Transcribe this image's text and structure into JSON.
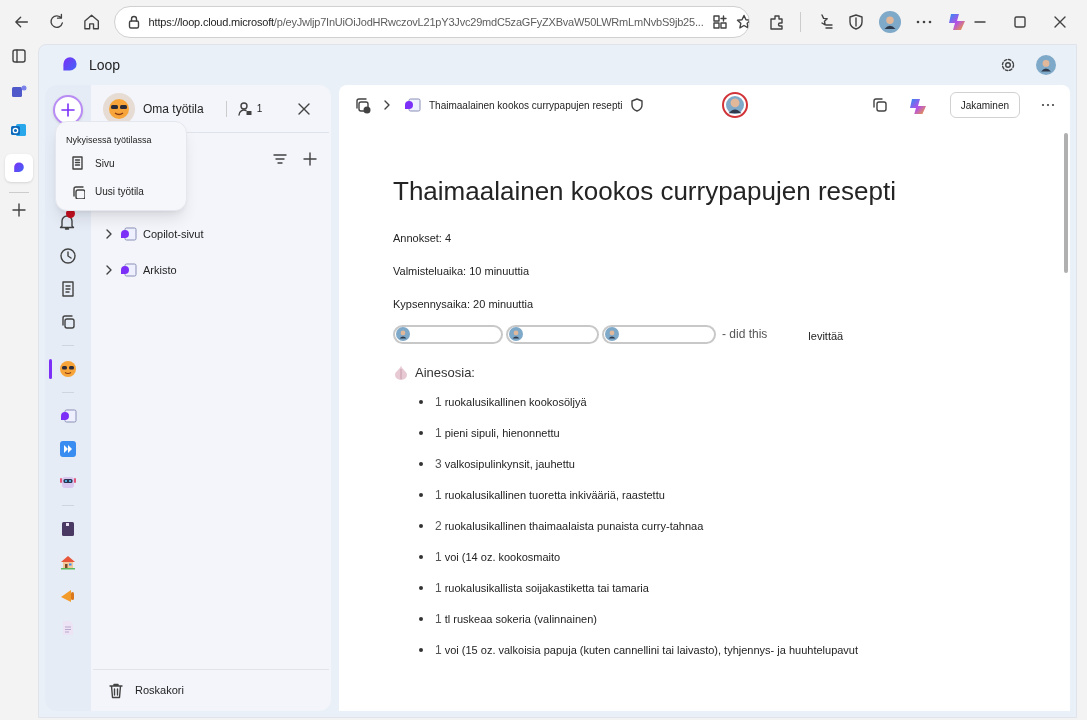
{
  "browser": {
    "url_host": "https://loop.cloud.microsoft",
    "url_path": "/p/eyJwljp7InUiOiJodHRwczovL21pY3Jvc29mdC5zaGFyZXBvaW50LWRmLmNvbS9jb25...",
    "side_apps": [
      {
        "kind": "teams",
        "selected": false
      },
      {
        "kind": "outlook",
        "selected": false
      },
      {
        "kind": "loop",
        "selected": true
      }
    ]
  },
  "app": {
    "title": "Loop"
  },
  "rail": [
    {
      "kind": "clock",
      "selected": false
    },
    {
      "kind": "notes",
      "selected": false
    },
    {
      "kind": "workspaces",
      "selected": false
    },
    {
      "kind": "divider"
    },
    {
      "kind": "sunglasses",
      "selected": true
    },
    {
      "kind": "divider"
    },
    {
      "kind": "loop-page",
      "selected": false
    },
    {
      "kind": "forward",
      "selected": false
    },
    {
      "kind": "robot",
      "selected": false
    },
    {
      "kind": "divider"
    },
    {
      "kind": "book",
      "selected": false
    },
    {
      "kind": "house",
      "selected": false
    },
    {
      "kind": "megaphone",
      "selected": false
    },
    {
      "kind": "document",
      "selected": false
    }
  ],
  "sidebar": {
    "workspace_name": "Oma työtila",
    "member_count": "1",
    "tree": [
      {
        "label": "Copilot-sivut",
        "expanded": false
      },
      {
        "label": "Arkisto",
        "expanded": false
      }
    ],
    "trash": "Roskakori"
  },
  "new_menu": {
    "heading": "Nykyisessä työtilassa",
    "items": [
      {
        "label": "Sivu",
        "kind": "page"
      },
      {
        "label": "Uusi työtila",
        "kind": "workspace"
      }
    ]
  },
  "page": {
    "breadcrumb": "Thaimaalainen kookos currypapujen resepti",
    "share_button": "Jakaminen",
    "title": "Thaimaalainen kookos currypapujen resepti",
    "fields": [
      "Annokset: 4",
      "Valmisteluaika: 10 minuuttia",
      "Kypsennysaika: 20 minuuttia"
    ],
    "mentions": {
      "chips": [
        {
          "kind": "person"
        },
        {
          "kind": "person"
        },
        {
          "kind": "person"
        }
      ],
      "suffix": "- did this",
      "trailing": "levittää"
    },
    "ingredients_heading": "Ainesosia:",
    "ingredients": [
      {
        "qty": "1",
        "text": "ruokalusikallinen kookosöljyä"
      },
      {
        "qty": "1",
        "text": "pieni sipuli, hienonnettu"
      },
      {
        "qty": "3",
        "text": "valkosipulinkynsit, jauhettu"
      },
      {
        "qty": "1",
        "text": "ruokalusikallinen tuoretta inkivääriä, raastettu"
      },
      {
        "qty": "2",
        "text": "ruokalusikallinen thaimaalaista punaista curry-tahnaa"
      },
      {
        "qty": "1",
        "text": "voi (14 oz. kookosmaito"
      },
      {
        "qty": "1",
        "text": "ruokalusikallista soijakastiketta tai tamaria"
      },
      {
        "qty": "1",
        "text": "tl ruskeaa sokeria (valinnainen)"
      },
      {
        "qty": "1",
        "text": "voi (15 oz. valkoisia papuja (kuten cannellini tai laivasto), tyhjennys- ja huuhtelupavut"
      }
    ]
  }
}
